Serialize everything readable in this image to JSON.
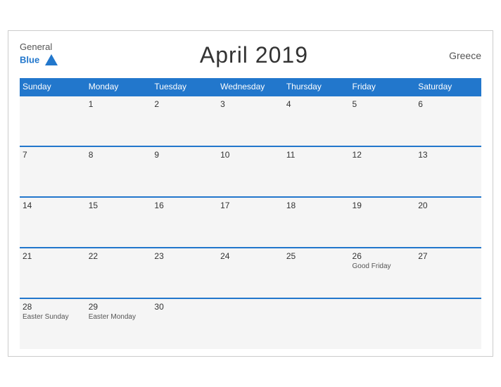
{
  "header": {
    "logo_general": "General",
    "logo_blue": "Blue",
    "title": "April 2019",
    "country": "Greece"
  },
  "days_of_week": [
    "Sunday",
    "Monday",
    "Tuesday",
    "Wednesday",
    "Thursday",
    "Friday",
    "Saturday"
  ],
  "weeks": [
    [
      {
        "day": "",
        "holiday": ""
      },
      {
        "day": "1",
        "holiday": ""
      },
      {
        "day": "2",
        "holiday": ""
      },
      {
        "day": "3",
        "holiday": ""
      },
      {
        "day": "4",
        "holiday": ""
      },
      {
        "day": "5",
        "holiday": ""
      },
      {
        "day": "6",
        "holiday": ""
      }
    ],
    [
      {
        "day": "7",
        "holiday": ""
      },
      {
        "day": "8",
        "holiday": ""
      },
      {
        "day": "9",
        "holiday": ""
      },
      {
        "day": "10",
        "holiday": ""
      },
      {
        "day": "11",
        "holiday": ""
      },
      {
        "day": "12",
        "holiday": ""
      },
      {
        "day": "13",
        "holiday": ""
      }
    ],
    [
      {
        "day": "14",
        "holiday": ""
      },
      {
        "day": "15",
        "holiday": ""
      },
      {
        "day": "16",
        "holiday": ""
      },
      {
        "day": "17",
        "holiday": ""
      },
      {
        "day": "18",
        "holiday": ""
      },
      {
        "day": "19",
        "holiday": ""
      },
      {
        "day": "20",
        "holiday": ""
      }
    ],
    [
      {
        "day": "21",
        "holiday": ""
      },
      {
        "day": "22",
        "holiday": ""
      },
      {
        "day": "23",
        "holiday": ""
      },
      {
        "day": "24",
        "holiday": ""
      },
      {
        "day": "25",
        "holiday": ""
      },
      {
        "day": "26",
        "holiday": "Good Friday"
      },
      {
        "day": "27",
        "holiday": ""
      }
    ],
    [
      {
        "day": "28",
        "holiday": "Easter Sunday"
      },
      {
        "day": "29",
        "holiday": "Easter Monday"
      },
      {
        "day": "30",
        "holiday": ""
      },
      {
        "day": "",
        "holiday": ""
      },
      {
        "day": "",
        "holiday": ""
      },
      {
        "day": "",
        "holiday": ""
      },
      {
        "day": "",
        "holiday": ""
      }
    ]
  ]
}
